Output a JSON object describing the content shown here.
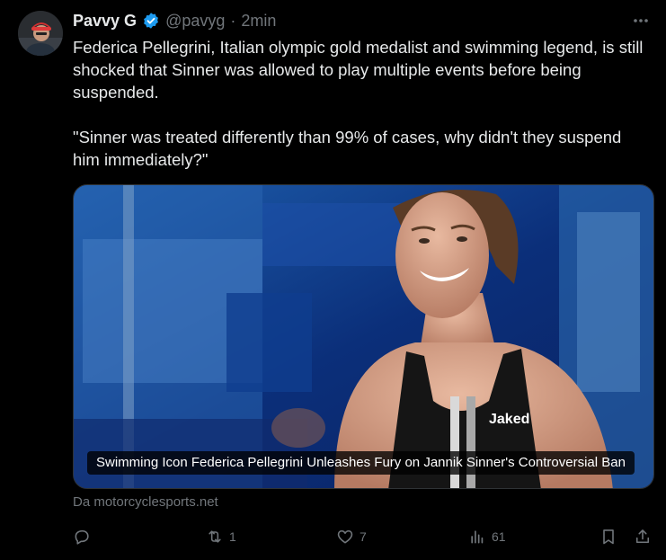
{
  "author": {
    "name": "Pavvy G",
    "handle": "@pavyg",
    "separator": "·",
    "time": "2min"
  },
  "tweet": {
    "paragraphs": [
      "Federica Pellegrini, Italian olympic gold medalist and swimming legend, is still shocked that Sinner was allowed to play multiple events before being suspended.",
      "\"Sinner was treated differently than 99% of cases, why didn't they suspend him immediately?\""
    ]
  },
  "card": {
    "title": "Swimming Icon Federica Pellegrini Unleashes Fury on Jannik Sinner's Controversial Ban",
    "swimsuit_brand": "Jaked",
    "source": "Da motorcyclesports.net"
  },
  "actions": {
    "reply": {
      "icon": "reply-icon",
      "count": ""
    },
    "retweet": {
      "icon": "retweet-icon",
      "count": "1"
    },
    "like": {
      "icon": "heart-icon",
      "count": "7"
    },
    "views": {
      "icon": "views-icon",
      "count": "61"
    },
    "bookmark": {
      "icon": "bookmark-icon"
    },
    "share": {
      "icon": "share-icon"
    }
  },
  "colors": {
    "background": "#000000",
    "text": "#e7e9ea",
    "muted": "#71767b",
    "verified": "#1d9bf0"
  }
}
